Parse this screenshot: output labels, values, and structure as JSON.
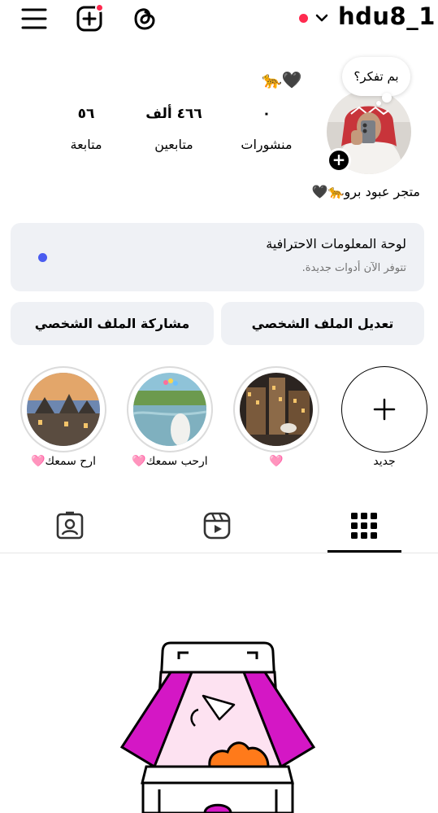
{
  "header": {
    "username": "hdu8_1",
    "icons": [
      "menu-icon",
      "add-content-icon",
      "threads-icon",
      "chevron-down-icon"
    ],
    "notification_color": "#ff2a4f"
  },
  "profile": {
    "note": "بم تفكر؟",
    "emoji_line": "🐆🖤",
    "stats": {
      "posts_value": "٠",
      "posts_label": "منشورات",
      "followers_value": "٤٦٦ ألف",
      "followers_label": "متابعين",
      "following_value": "٥٦",
      "following_label": "متابعة"
    },
    "bio": "متجر عبود برو🐆🖤"
  },
  "dashboard": {
    "title": "لوحة المعلومات الاحترافية",
    "subtitle": "تتوفر الآن أدوات جديدة.",
    "dot_color": "#4a5cf0"
  },
  "actions": {
    "edit_profile": "تعديل الملف الشخصي",
    "share_profile": "مشاركة الملف الشخصي"
  },
  "highlights": [
    {
      "label": "جديد"
    },
    {
      "label": "🩷"
    },
    {
      "label": "ارحب سمعك🩷"
    },
    {
      "label": "ارح سمعك🩷"
    }
  ],
  "tabs": [
    "grid-icon",
    "reels-icon",
    "tagged-icon"
  ]
}
